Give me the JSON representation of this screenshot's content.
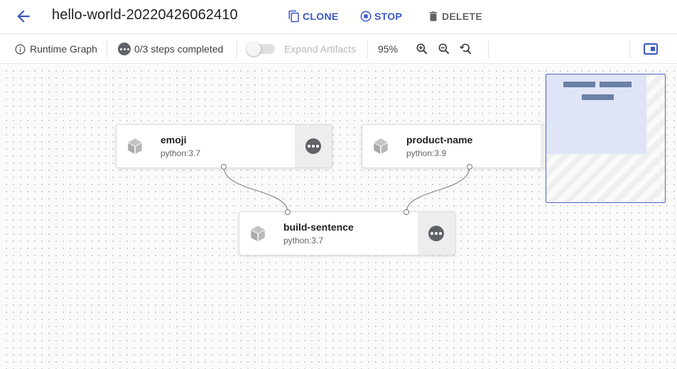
{
  "header": {
    "title": "hello-world-20220426062410",
    "clone_label": "CLONE",
    "stop_label": "STOP",
    "delete_label": "DELETE"
  },
  "toolbar": {
    "runtime_graph_label": "Runtime Graph",
    "steps_label": "0/3 steps completed",
    "expand_artifacts_label": "Expand Artifacts",
    "expand_artifacts_on": false,
    "zoom_level": "95%"
  },
  "graph": {
    "nodes": [
      {
        "name": "emoji",
        "image": "python:3.7"
      },
      {
        "name": "product-name",
        "image": "python:3.9"
      },
      {
        "name": "build-sentence",
        "image": "python:3.7"
      }
    ]
  },
  "colors": {
    "accent": "#3a57c5",
    "muted": "#5f6368",
    "minimap_border": "#4b67c9"
  },
  "icons": [
    "arrow-back-icon",
    "clone-icon",
    "stop-icon",
    "delete-icon",
    "info-icon",
    "more-horiz-icon",
    "zoom-in-icon",
    "zoom-out-icon",
    "zoom-reset-icon",
    "side-panel-icon",
    "cube-icon"
  ]
}
